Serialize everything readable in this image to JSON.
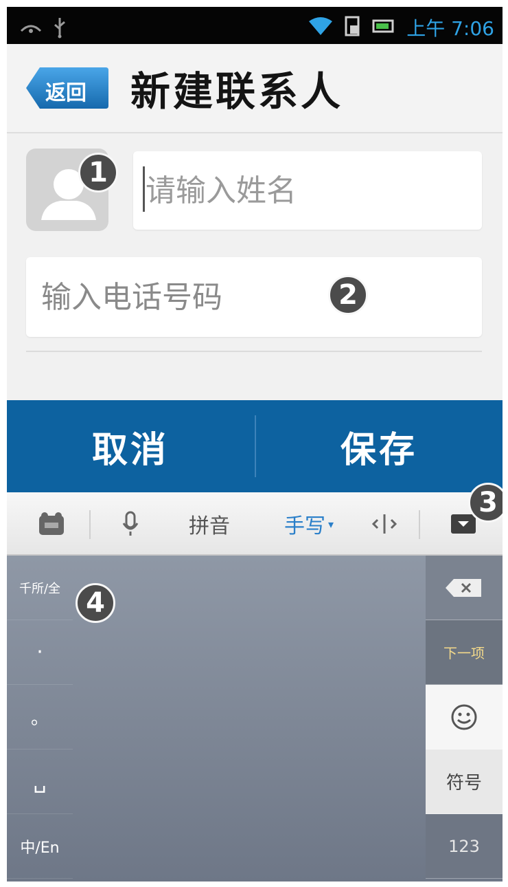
{
  "status_bar": {
    "time": "上午 7:06",
    "icons": [
      "notification-icon",
      "usb-icon",
      "wifi-icon",
      "sim-icon",
      "battery-icon"
    ]
  },
  "header": {
    "back_label": "返回",
    "title": "新建联系人"
  },
  "form": {
    "name_placeholder": "请输入姓名",
    "phone_placeholder": "输入电话号码"
  },
  "markers": [
    "1",
    "2",
    "3",
    "4"
  ],
  "actions": {
    "cancel_label": "取消",
    "save_label": "保存"
  },
  "keyboard": {
    "toolbar": {
      "settings_icon": "keyboard-settings-icon",
      "voice_icon": "microphone-icon",
      "pinyin_label": "拼音",
      "handwriting_label": "手写",
      "cursor_icon": "cursor-move-icon",
      "hide_icon": "keyboard-hide-icon"
    },
    "left_keys": [
      "千所/全",
      "·",
      "。",
      "␣",
      "中/En"
    ],
    "right_keys": {
      "backspace_icon": "backspace-icon",
      "next_label": "下一项",
      "emoji_icon": "emoji-icon",
      "symbol_label": "符号",
      "number_label": "123"
    }
  },
  "colors": {
    "status_bar_bg": "#050505",
    "status_accent": "#2fa3e6",
    "action_bar_bg": "#0d62a0",
    "handwriting_accent": "#2a7fc9",
    "keyboard_bg": "#7f8897"
  }
}
